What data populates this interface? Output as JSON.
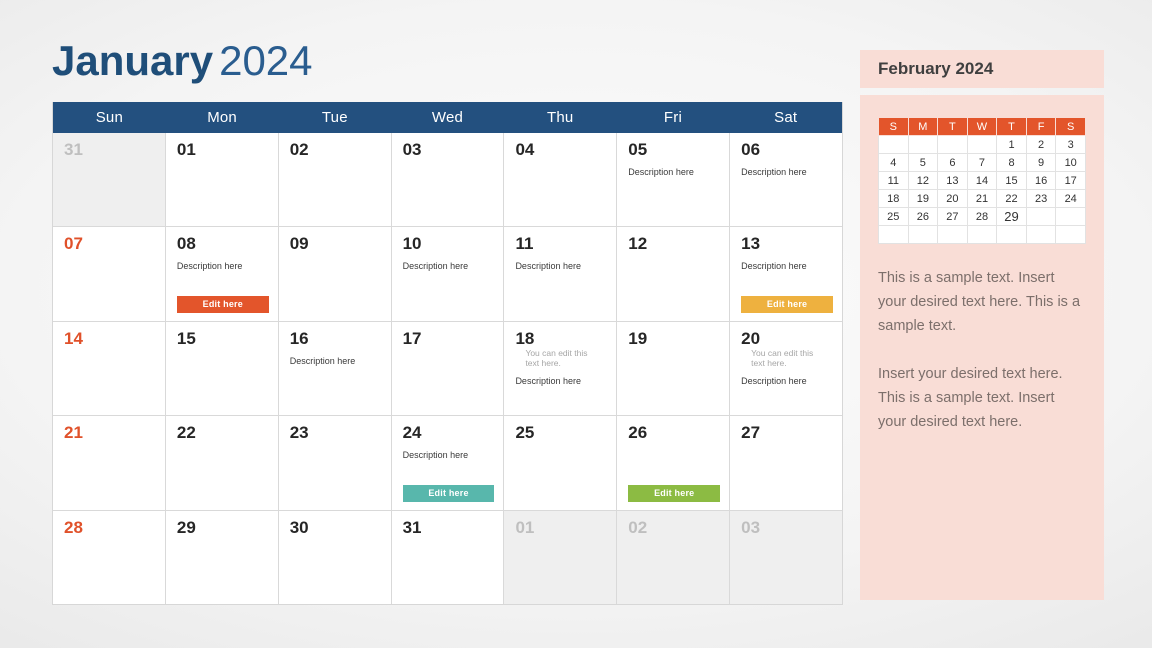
{
  "title": {
    "month": "January",
    "year": "2024"
  },
  "colors": {
    "header_blue": "#23507f",
    "sunday_orange": "#e0512a",
    "accent_orange": "#e3552b",
    "accent_amber": "#eeb13f",
    "accent_teal": "#58b7ac",
    "accent_green": "#8cbb43",
    "panel_pink": "#f9ddd6",
    "title_blue": "#1f4e79"
  },
  "calendar": {
    "day_headers": [
      "Sun",
      "Mon",
      "Tue",
      "Wed",
      "Thu",
      "Fri",
      "Sat"
    ],
    "weeks": [
      [
        {
          "num": "31",
          "muted": true
        },
        {
          "num": "01"
        },
        {
          "num": "02"
        },
        {
          "num": "03"
        },
        {
          "num": "04"
        },
        {
          "num": "05",
          "desc": "Description here"
        },
        {
          "num": "06",
          "desc": "Description here"
        }
      ],
      [
        {
          "num": "07",
          "sunday": true
        },
        {
          "num": "08",
          "desc": "Description here",
          "button": {
            "label": "Edit here",
            "color": "orange"
          }
        },
        {
          "num": "09"
        },
        {
          "num": "10",
          "desc": "Description here"
        },
        {
          "num": "11",
          "desc": "Description here"
        },
        {
          "num": "12"
        },
        {
          "num": "13",
          "desc": "Description here",
          "button": {
            "label": "Edit here",
            "color": "amber"
          }
        }
      ],
      [
        {
          "num": "14",
          "sunday": true
        },
        {
          "num": "15"
        },
        {
          "num": "16",
          "desc": "Description here"
        },
        {
          "num": "17"
        },
        {
          "num": "18",
          "note": "You can edit this text here.",
          "desc": "Description here"
        },
        {
          "num": "19"
        },
        {
          "num": "20",
          "note": "You can edit this text here.",
          "desc": "Description here"
        }
      ],
      [
        {
          "num": "21",
          "sunday": true
        },
        {
          "num": "22"
        },
        {
          "num": "23"
        },
        {
          "num": "24",
          "desc": "Description here",
          "button": {
            "label": "Edit here",
            "color": "teal"
          }
        },
        {
          "num": "25"
        },
        {
          "num": "26",
          "button": {
            "label": "Edit here",
            "color": "green"
          }
        },
        {
          "num": "27"
        }
      ],
      [
        {
          "num": "28",
          "sunday": true
        },
        {
          "num": "29"
        },
        {
          "num": "30"
        },
        {
          "num": "31"
        },
        {
          "num": "01",
          "muted": true
        },
        {
          "num": "02",
          "muted": true
        },
        {
          "num": "03",
          "muted": true
        }
      ]
    ]
  },
  "side": {
    "header_label": "February 2024",
    "mini_calendar": {
      "day_headers": [
        "S",
        "M",
        "T",
        "W",
        "T",
        "F",
        "S"
      ],
      "weeks": [
        [
          "",
          "",
          "",
          "",
          "1",
          "2",
          "3"
        ],
        [
          "4",
          "5",
          "6",
          "7",
          "8",
          "9",
          "10"
        ],
        [
          "11",
          "12",
          "13",
          "14",
          "15",
          "16",
          "17"
        ],
        [
          "18",
          "19",
          "20",
          "21",
          "22",
          "23",
          "24"
        ],
        [
          "25",
          "26",
          "27",
          "28",
          "29",
          "",
          ""
        ],
        [
          "",
          "",
          "",
          "",
          "",
          "",
          ""
        ]
      ],
      "highlighted": "29"
    },
    "paragraphs": [
      "This is a sample text. Insert your desired text here. This is a sample text.",
      "Insert your desired text here. This is a sample text. Insert your desired text here."
    ]
  }
}
